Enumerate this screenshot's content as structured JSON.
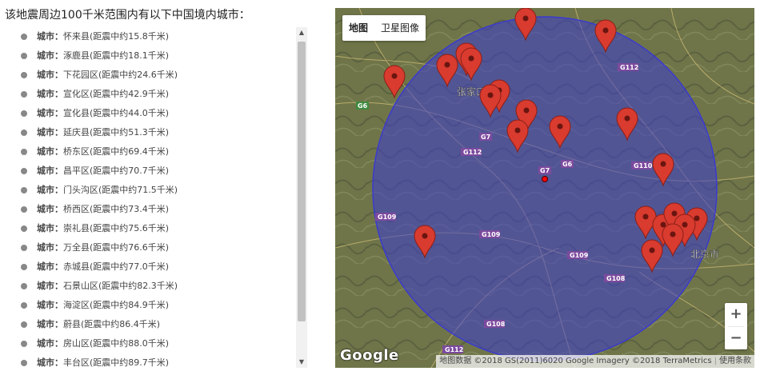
{
  "heading": "该地震周边100千米范围内有以下中国境内城市：",
  "cities": [
    {
      "label": "城市：",
      "value": "怀来县(距震中约15.8千米)"
    },
    {
      "label": "城市：",
      "value": "涿鹿县(距震中约18.1千米)"
    },
    {
      "label": "城市：",
      "value": "下花园区(距震中约24.6千米)"
    },
    {
      "label": "城市：",
      "value": "宣化区(距震中约42.9千米)"
    },
    {
      "label": "城市：",
      "value": "宣化县(距震中约44.0千米)"
    },
    {
      "label": "城市：",
      "value": "延庆县(距震中约51.3千米)"
    },
    {
      "label": "城市：",
      "value": "桥东区(距震中约69.4千米)"
    },
    {
      "label": "城市：",
      "value": "昌平区(距震中约70.7千米)"
    },
    {
      "label": "城市：",
      "value": "门头沟区(距震中约71.5千米)"
    },
    {
      "label": "城市：",
      "value": "桥西区(距震中约73.4千米)"
    },
    {
      "label": "城市：",
      "value": "崇礼县(距震中约75.6千米)"
    },
    {
      "label": "城市：",
      "value": "万全县(距震中约76.6千米)"
    },
    {
      "label": "城市：",
      "value": "赤城县(距震中约77.0千米)"
    },
    {
      "label": "城市：",
      "value": "石景山区(距震中约82.3千米)"
    },
    {
      "label": "城市：",
      "value": "海淀区(距震中约84.9千米)"
    },
    {
      "label": "城市：",
      "value": "蔚县(距震中约86.4千米)"
    },
    {
      "label": "城市：",
      "value": "房山区(距震中约88.0千米)"
    },
    {
      "label": "城市：",
      "value": "丰台区(距震中约89.7千米)"
    }
  ],
  "map": {
    "type_buttons": {
      "map": "地图",
      "satellite": "卫星图像"
    },
    "zoom_in": "+",
    "zoom_out": "−",
    "logo": "Google",
    "attribution": "地图数据 ©2018 GS(2011)6020 Google Imagery ©2018 TerraMetrics",
    "terms": "使用条款",
    "road_labels": [
      "G112",
      "G6",
      "G7",
      "G6",
      "G7",
      "G112",
      "G110",
      "G109",
      "G109",
      "G109",
      "G108",
      "G108",
      "G112"
    ],
    "place_labels": [
      "张家口市",
      "北京市"
    ],
    "colors": {
      "circle": "#3a3acf",
      "marker": "#d93b2f",
      "epicenter": "#ff0000"
    }
  }
}
